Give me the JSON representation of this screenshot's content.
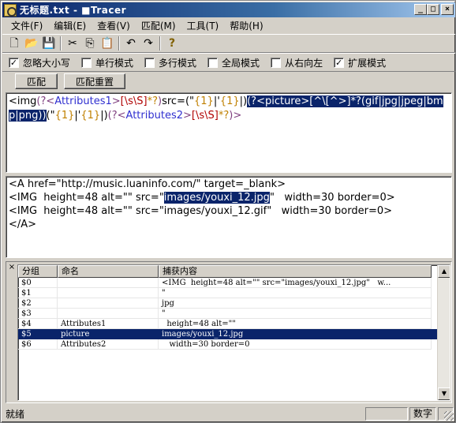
{
  "window": {
    "title": "无标题.txt - ■Tracer",
    "controls": {
      "minimize": "_",
      "maximize": "□",
      "close": "×"
    }
  },
  "menu": [
    "文件(F)",
    "编辑(E)",
    "查看(V)",
    "匹配(M)",
    "工具(T)",
    "帮助(H)"
  ],
  "toolbar": {
    "icons": [
      "new-file-icon",
      "open-folder-icon",
      "save-icon",
      "cut-icon",
      "copy-icon",
      "paste-icon",
      "undo-icon",
      "redo-icon",
      "help-icon"
    ],
    "glyphs": [
      "🗋",
      "📂",
      "💾",
      "✂",
      "⎘",
      "📋",
      "↶",
      "↷",
      "?"
    ]
  },
  "options": [
    {
      "label": "忽略大小写",
      "checked": true
    },
    {
      "label": "单行模式",
      "checked": false
    },
    {
      "label": "多行模式",
      "checked": false
    },
    {
      "label": "全局模式",
      "checked": false
    },
    {
      "label": "从右向左",
      "checked": false
    },
    {
      "label": "扩展模式",
      "checked": true
    }
  ],
  "actions": {
    "match": "匹配",
    "reset": "匹配重置"
  },
  "regex": {
    "segments": [
      {
        "text": "<img",
        "color": "#000000",
        "sel": false
      },
      {
        "text": "(?<",
        "color": "#7f3f7f",
        "sel": false
      },
      {
        "text": "Attributes1",
        "color": "#3030d0",
        "sel": false
      },
      {
        "text": ">",
        "color": "#7f3f7f",
        "sel": false
      },
      {
        "text": "[\\s\\S]",
        "color": "#b00000",
        "sel": false
      },
      {
        "text": "*?",
        "color": "#c08000",
        "sel": false
      },
      {
        "text": ")",
        "color": "#7f3f7f",
        "sel": false
      },
      {
        "text": "src=(\"",
        "color": "#000000",
        "sel": false
      },
      {
        "text": "{1}",
        "color": "#c08000",
        "sel": false
      },
      {
        "text": "|'",
        "color": "#000000",
        "sel": false
      },
      {
        "text": "{1}",
        "color": "#c08000",
        "sel": false
      },
      {
        "text": "|)",
        "color": "#000000",
        "sel": false
      },
      {
        "text": "(?<picture>[^\\[^>]*?(gif|jpg|jpeg|bmp|png))",
        "color": "#ffffff",
        "sel": true
      },
      {
        "text": "(\"",
        "color": "#000000",
        "sel": false
      },
      {
        "text": "{1}",
        "color": "#c08000",
        "sel": false
      },
      {
        "text": "|'",
        "color": "#000000",
        "sel": false
      },
      {
        "text": "{1}",
        "color": "#c08000",
        "sel": false
      },
      {
        "text": "|)",
        "color": "#000000",
        "sel": false
      },
      {
        "text": "(?<",
        "color": "#7f3f7f",
        "sel": false
      },
      {
        "text": "Attributes2",
        "color": "#3030d0",
        "sel": false
      },
      {
        "text": ">",
        "color": "#7f3f7f",
        "sel": false
      },
      {
        "text": "[\\s\\S]",
        "color": "#b00000",
        "sel": false
      },
      {
        "text": "*?",
        "color": "#c08000",
        "sel": false
      },
      {
        "text": ")>",
        "color": "#7f3f7f",
        "sel": false
      }
    ]
  },
  "sample": {
    "line1": "<A href=\"http://music.luaninfo.com/\" target=_blank>",
    "line2_pre": "<IMG  height=48 alt=\"\" src=\"",
    "line2_hl": "images/youxi_12.jpg",
    "line2_post": "\"   width=30 border=0>",
    "line3": "<IMG  height=48 alt=\"\" src=\"images/youxi_12.gif\"   width=30 border=0>",
    "line4": "</A>"
  },
  "results": {
    "columns": [
      "分组",
      "命名",
      "捕获内容"
    ],
    "rows": [
      {
        "group": "$0",
        "name": "",
        "content": "<IMG  height=48 alt=\"\" src=\"images/youxi_12.jpg\"   w...",
        "selected": false
      },
      {
        "group": "$1",
        "name": "",
        "content": "\"",
        "selected": false
      },
      {
        "group": "$2",
        "name": "",
        "content": "jpg",
        "selected": false
      },
      {
        "group": "$3",
        "name": "",
        "content": "\"",
        "selected": false
      },
      {
        "group": "$4",
        "name": "Attributes1",
        "content": "  height=48 alt=\"\"",
        "selected": false
      },
      {
        "group": "$5",
        "name": "picture",
        "content": "images/youxi_12.jpg",
        "selected": true
      },
      {
        "group": "$6",
        "name": "Attributes2",
        "content": "   width=30 border=0",
        "selected": false
      }
    ]
  },
  "status": {
    "text": "就绪",
    "panes": [
      "",
      "数字",
      ""
    ]
  }
}
